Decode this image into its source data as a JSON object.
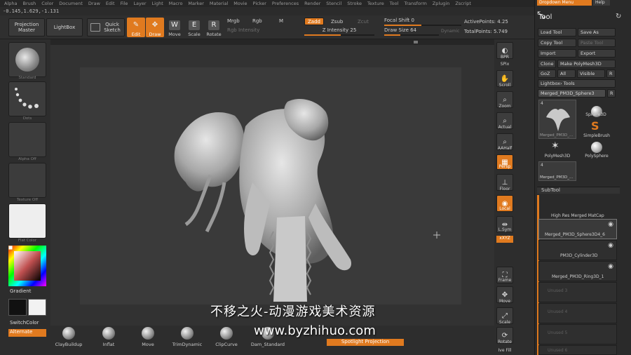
{
  "menu": [
    "Alpha",
    "Brush",
    "Color",
    "Document",
    "Draw",
    "Edit",
    "File",
    "Layer",
    "Light",
    "Macro",
    "Marker",
    "Material",
    "Movie",
    "Picker",
    "Preferences",
    "Render",
    "Stencil",
    "Stroke",
    "Texture",
    "Tool",
    "Transform",
    "Zplugin",
    "Zscript"
  ],
  "coords": "-0.145,1.629,-1.131",
  "top_shelf": {
    "projection_master": "Projection Master",
    "lightbox": "LightBox",
    "quick_sketch": "Quick Sketch",
    "edit": "Edit",
    "draw": "Draw",
    "move": "Move",
    "scale": "Scale",
    "rotate": "Rotate",
    "mrgb": "Mrgb",
    "rgb": "Rgb",
    "m": "M",
    "rgb_intensity": "Rgb Intensity",
    "zadd": "Zadd",
    "zsub": "Zsub",
    "zcut": "Zcut",
    "z_intensity": "Z Intensity 25",
    "focal_shift": "Focal Shift 0",
    "draw_size": "Draw Size 64",
    "dynamic": "Dynamic",
    "active_points": "ActivePoints: 4.25",
    "total_points": "TotalPoints: 5.749"
  },
  "left_shelf": {
    "brush_label": "Standard",
    "stroke_label": "Dots",
    "alpha_label": "Alpha Off",
    "texture_label": "Texture Off",
    "material_label": "Flat Color",
    "gradient_label": "Gradient",
    "switch_color_label": "SwitchColor",
    "alternate_label": "Alternate"
  },
  "bottom_shelf": {
    "brushes": [
      "ClayBuildup",
      "Inflat",
      "Move",
      "TrimDynamic",
      "ClipCurve",
      "Dam_Standard"
    ],
    "spotlight": "Spotlight Projection"
  },
  "right_shelf": {
    "items": [
      "BPR",
      "SPix",
      "Scroll",
      "Zoom",
      "Actual",
      "AAHalf",
      "Persp",
      "Floor",
      "Local",
      "L.Sym",
      "xXYZ",
      "Frame",
      "Move",
      "Scale",
      "Rotate"
    ],
    "bottom_label": "Ive Fill"
  },
  "tool_panel": {
    "top_tab1": "Dropdown Menu",
    "top_tab2": "Help",
    "title": "Tool",
    "buttons": {
      "load_tool": "Load Tool",
      "save_as": "Save As",
      "copy_tool": "Copy Tool",
      "paste_tool": "Paste Tool",
      "import": "Import",
      "export": "Export",
      "clone": "Clone",
      "make_polymesh": "Make PolyMesh3D",
      "goz": "GoZ",
      "all": "All",
      "visible": "Visible",
      "r": "R"
    },
    "lightbox_tools": "Lightbox› Tools",
    "current_tool": "Merged_PM3D_Sphere3",
    "tool_count": "4",
    "tools": [
      "Merged_PM3D_...",
      "Sphere3D",
      "SimpleBrush",
      "PolyMesh3D",
      "PolySphere",
      "Merged_PM3D_..."
    ],
    "subtool_title": "SubTool",
    "subtool_header": "High Res  Merged MatCap",
    "subtools": [
      "Merged_PM3D_Sphere3D4_6",
      "PM3D_Cylinder3D",
      "Merged_PM3D_Ring3D_1"
    ],
    "unused": [
      "Unused 3",
      "Unused 4",
      "Unused 5",
      "Unused 6",
      "Unused 7"
    ]
  },
  "watermark": {
    "cn": "不移之火-动漫游戏美术资源",
    "url": "www.byzhihuo.com"
  },
  "colors": {
    "accent": "#e07a1f",
    "bg": "#2b2b2b",
    "canvas": "#3a3a3a"
  }
}
